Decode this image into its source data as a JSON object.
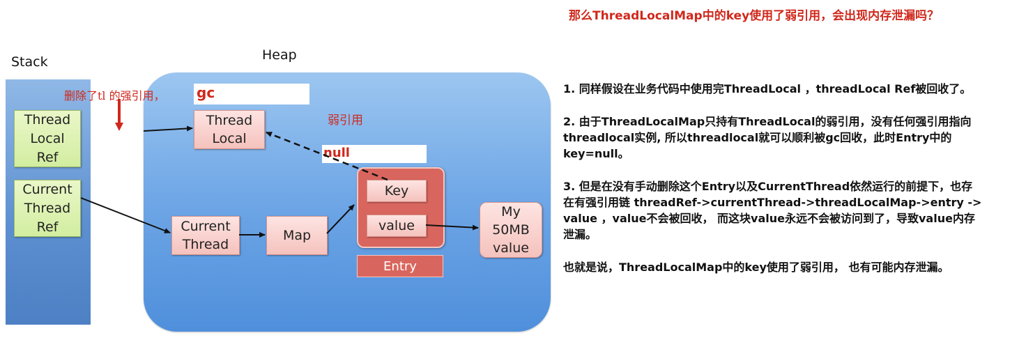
{
  "question": "那么ThreadLocalMap中的key使用了弱引用，会出现内存泄漏吗？",
  "diagram": {
    "stack_label": "Stack",
    "heap_label": "Heap",
    "thread_local_ref": "Thread\nLocal\nRef",
    "current_thread_ref": "Current\nThread\nRef",
    "thread_local": "Thread\nLocal",
    "current_thread": "Current\nThread",
    "map": "Map",
    "key": "Key",
    "value": "value",
    "entry": "Entry",
    "my_value": "My\n50MB\nvalue",
    "annotation_deleted": "删除了tl 的强引用，",
    "annotation_gc": "gc",
    "annotation_weak": "弱引用",
    "annotation_null": "null"
  },
  "explanation": {
    "p1": "1. 同样假设在业务代码中使用完ThreadLocal ，threadLocal Ref被回收了。",
    "p2a": "2. 由于ThreadLocalMap只持有ThreadLocal的弱引用，没有任何强引用指向",
    "p2b": "threadlocal实例, 所以threadlocal就可以顺利被gc回收，此时Entry中的",
    "p2c": "key=null。",
    "p3a": "3. 但是在没有手动删除这个Entry以及CurrentThread依然运行的前提下，也存",
    "p3b": "在有强引用链 threadRef->currentThread->threadLocalMap->entry ->",
    "p3c": "value ，value不会被回收， 而这块value永远不会被访问到了，导致value内存",
    "p3d": "泄漏。",
    "p4": "也就是说，ThreadLocalMap中的key使用了弱引用， 也有可能内存泄漏。"
  },
  "colors": {
    "accent_red": "#d0281c",
    "stack_blue": "#5c8fd0",
    "heap_blue": "#6ea6e6",
    "entry_red": "#d9665e"
  }
}
